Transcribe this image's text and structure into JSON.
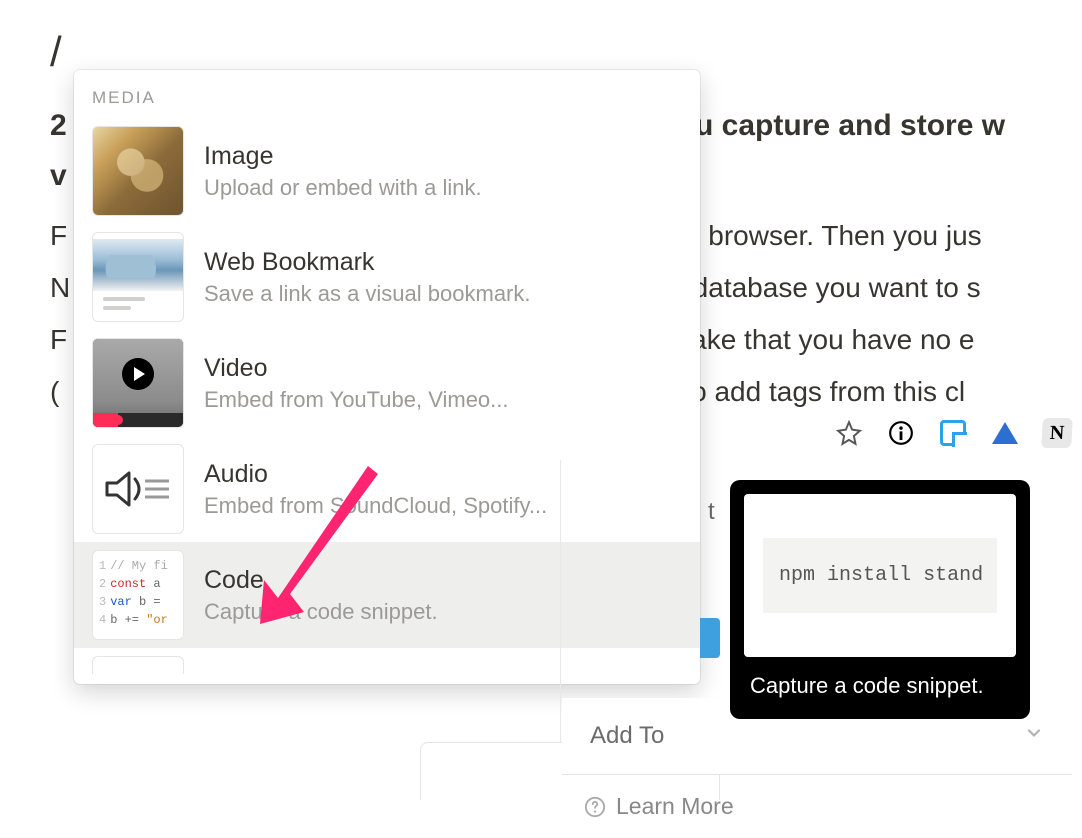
{
  "cursor": "/",
  "background": {
    "heading_left": "2",
    "heading_right": "you capture and store w",
    "heading_left2": "v",
    "para_r1": "our browser. Then you jus",
    "para_r2": "or database you want to s",
    "para_r3": "o take that you have no e",
    "para_r4": "e to add tags from this cl",
    "para_l1": "F",
    "para_l2": "N",
    "para_l3": "F",
    "para_l4": "(",
    "t_behind": "t"
  },
  "menu": {
    "section": "MEDIA",
    "items": [
      {
        "title": "Image",
        "desc": "Upload or embed with a link."
      },
      {
        "title": "Web Bookmark",
        "desc": "Save a link as a visual bookmark."
      },
      {
        "title": "Video",
        "desc": "Embed from YouTube, Vimeo..."
      },
      {
        "title": "Audio",
        "desc": "Embed from SoundCloud, Spotify..."
      },
      {
        "title": "Code",
        "desc": "Capture a code snippet."
      }
    ],
    "code_thumb": {
      "l1": "// My fi",
      "l2a": "const",
      "l2b": " a",
      "l3a": "var",
      "l3b": " b =",
      "l4a": "b +=",
      "l4b": "\"or"
    }
  },
  "tooltip": {
    "code": "npm install stand",
    "caption": "Capture a code snippet."
  },
  "clipper": {
    "addto_label": "Add To",
    "learn_more": "Learn More"
  }
}
